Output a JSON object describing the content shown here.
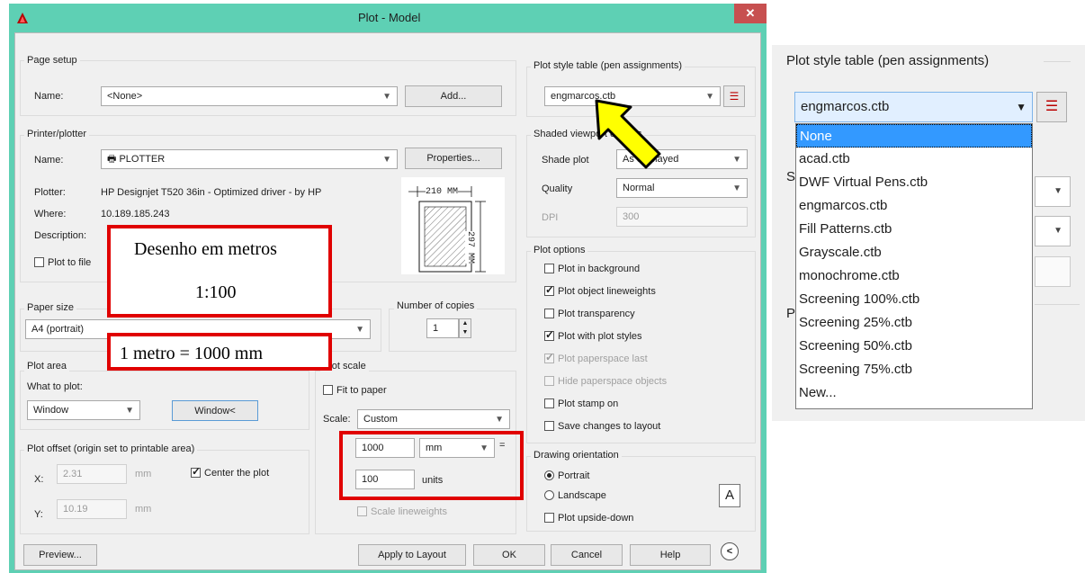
{
  "dialog": {
    "title": "Plot - Model",
    "close_glyph": "✕",
    "page_setup": {
      "caption": "Page setup",
      "name_label": "Name:",
      "name_value": "<None>",
      "add_label": "Add..."
    },
    "printer": {
      "caption": "Printer/plotter",
      "name_label": "Name:",
      "name_value": "PLOTTER",
      "properties_label": "Properties...",
      "plotter_label": "Plotter:",
      "plotter_value": "HP Designjet T520 36in - Optimized driver - by HP",
      "where_label": "Where:",
      "where_value": "10.189.185.243",
      "description_label": "Description:",
      "plot_to_file_label": "Plot to file",
      "preview_width": "210 MM",
      "preview_height": "297 MM"
    },
    "paper_size": {
      "caption": "Paper size",
      "value": "A4 (portrait)"
    },
    "copies": {
      "caption": "Number of copies",
      "value": "1"
    },
    "plot_area": {
      "caption": "Plot area",
      "what_label": "What to plot:",
      "what_value": "Window",
      "window_button": "Window<"
    },
    "plot_offset": {
      "caption": "Plot offset (origin set to printable area)",
      "x_label": "X:",
      "x_value": "2.31",
      "x_unit": "mm",
      "y_label": "Y:",
      "y_value": "10.19",
      "y_unit": "mm",
      "center_label": "Center the plot"
    },
    "plot_scale": {
      "caption": "Plot scale",
      "fit_label": "Fit to paper",
      "scale_label": "Scale:",
      "scale_value": "Custom",
      "value1": "1000",
      "unit1": "mm",
      "equals": "=",
      "value2": "100",
      "unit2": "units",
      "lineweights_label": "Scale lineweights"
    },
    "plot_style": {
      "caption": "Plot style table (pen assignments)",
      "value": "engmarcos.ctb"
    },
    "shaded": {
      "caption": "Shaded viewport options",
      "shade_label": "Shade plot",
      "shade_value": "As displayed",
      "quality_label": "Quality",
      "quality_value": "Normal",
      "dpi_label": "DPI",
      "dpi_value": "300"
    },
    "plot_options": {
      "caption": "Plot options",
      "items": [
        {
          "label": "Plot in background",
          "checked": false,
          "disabled": false
        },
        {
          "label": "Plot object lineweights",
          "checked": true,
          "disabled": false
        },
        {
          "label": "Plot transparency",
          "checked": false,
          "disabled": false
        },
        {
          "label": "Plot with plot styles",
          "checked": true,
          "disabled": false
        },
        {
          "label": "Plot paperspace last",
          "checked": true,
          "disabled": true
        },
        {
          "label": "Hide paperspace objects",
          "checked": false,
          "disabled": true
        },
        {
          "label": "Plot stamp on",
          "checked": false,
          "disabled": false
        },
        {
          "label": "Save changes to layout",
          "checked": false,
          "disabled": false
        }
      ]
    },
    "orientation": {
      "caption": "Drawing orientation",
      "portrait_label": "Portrait",
      "landscape_label": "Landscape",
      "upside_label": "Plot upside-down",
      "icon_letter": "A"
    },
    "buttons": {
      "preview": "Preview...",
      "apply": "Apply to Layout",
      "ok": "OK",
      "cancel": "Cancel",
      "help": "Help",
      "collapse": "<"
    }
  },
  "annotations": {
    "line1": "Desenho em metros",
    "line2": "1:100",
    "line3": "1 metro = 1000 mm"
  },
  "zoom_panel": {
    "caption": "Plot style table (pen assignments)",
    "selected": "engmarcos.ctb",
    "options": [
      "None",
      "acad.ctb",
      "DWF Virtual Pens.ctb",
      "engmarcos.ctb",
      "Fill Patterns.ctb",
      "Grayscale.ctb",
      "monochrome.ctb",
      "Screening 100%.ctb",
      "Screening 25%.ctb",
      "Screening 50%.ctb",
      "Screening 75%.ctb",
      "New..."
    ],
    "highlighted_option": "None"
  },
  "colors": {
    "title_bar": "#5ed0b4",
    "close_button": "#c75050",
    "annotation_red": "#e00000",
    "arrow_yellow": "#ffff00",
    "selection_blue": "#3399ff"
  }
}
